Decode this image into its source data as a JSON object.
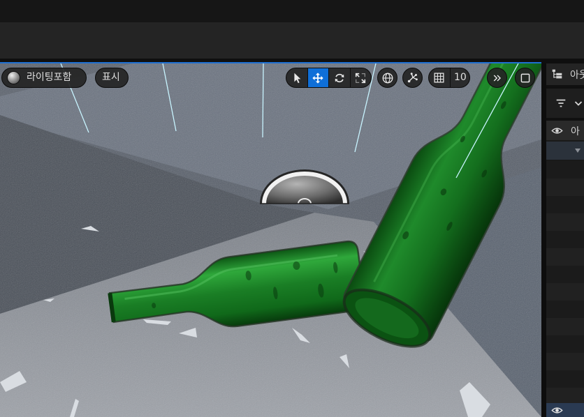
{
  "viewport": {
    "lighting_mode": {
      "label": "라이팅포함",
      "icon": "lit-sphere-icon"
    },
    "show_menu": {
      "label": "표시"
    },
    "transform_tools": [
      {
        "icon": "cursor-icon",
        "active": false
      },
      {
        "icon": "move-icon",
        "active": true
      },
      {
        "icon": "rotate-icon",
        "active": false
      },
      {
        "icon": "scale-icon",
        "active": false
      }
    ],
    "coordinate_space_icon": "globe-icon",
    "surface_snap_icon": "surface-snap-icon",
    "grid_snap": {
      "icon": "grid-icon",
      "value": "10"
    },
    "overflow_icon": "double-chevron-right-icon",
    "maximize_icon": "maximize-icon"
  },
  "outliner": {
    "title": "아웃",
    "title_icon": "outliner-icon",
    "filter_icon": "filter-icon",
    "filter_dropdown_icon": "chevron-down-icon",
    "column_visibility_icon": "eye-icon",
    "column_label": "아",
    "expand_icon": "triangle-down-icon",
    "bottom_row_icon": "eye-icon"
  },
  "colors": {
    "accent": "#0f6fd8",
    "viewport_border": "#1f6fd0",
    "bottle_green": "#1e8a2a",
    "light_ray": "#c8f4ff"
  }
}
